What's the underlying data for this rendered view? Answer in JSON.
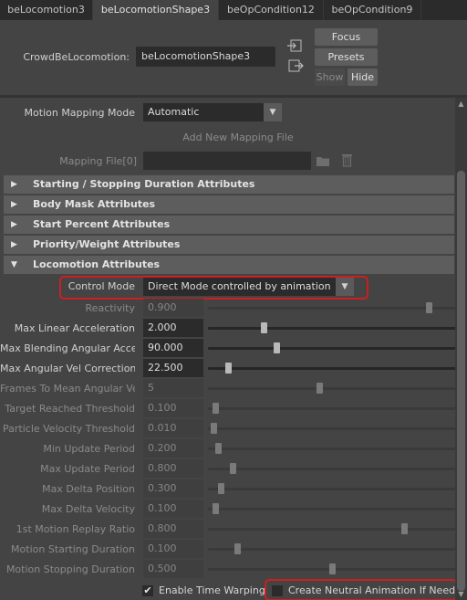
{
  "tabs": [
    "beLocomotion3",
    "beLocomotionShape3",
    "beOpCondition12",
    "beOpCondition9"
  ],
  "active_tab_index": 1,
  "header": {
    "node_type_label": "CrowdBeLocomotion:",
    "node_name": "beLocomotionShape3",
    "focus_label": "Focus",
    "presets_label": "Presets",
    "show_label": "Show",
    "hide_label": "Hide"
  },
  "mapping": {
    "mode_label": "Motion Mapping Mode",
    "mode_value": "Automatic",
    "add_button_label": "Add New Mapping File",
    "file_label": "Mapping File[0]",
    "file_value": ""
  },
  "sections": [
    {
      "label": "Starting / Stopping Duration Attributes",
      "expanded": false
    },
    {
      "label": "Body Mask Attributes",
      "expanded": false
    },
    {
      "label": "Start Percent Attributes",
      "expanded": false
    },
    {
      "label": "Priority/Weight Attributes",
      "expanded": false
    },
    {
      "label": "Locomotion Attributes",
      "expanded": true
    }
  ],
  "locomotion": {
    "control_mode_label": "Control Mode",
    "control_mode_value": "Direct Mode controlled by animation",
    "attributes": [
      {
        "label": "Reactivity",
        "value": "0.900",
        "enabled": false,
        "slider": 0.9
      },
      {
        "label": "Max Linear Acceleration",
        "value": "2.000",
        "enabled": true,
        "slider": 0.22
      },
      {
        "label": "Max Blending Angular Accel",
        "value": "90.000",
        "enabled": true,
        "slider": 0.27
      },
      {
        "label": "Max Angular Vel Correction",
        "value": "22.500",
        "enabled": true,
        "slider": 0.07
      },
      {
        "label": "Frames To Mean Angular Vel",
        "value": "5",
        "enabled": false,
        "slider": 0.45
      },
      {
        "label": "Target Reached Threshold",
        "value": "0.100",
        "enabled": false,
        "slider": 0.02
      },
      {
        "label": "Particle Velocity Threshold",
        "value": "0.010",
        "enabled": false,
        "slider": 0.01
      },
      {
        "label": "Min Update Period",
        "value": "0.200",
        "enabled": false,
        "slider": 0.03
      },
      {
        "label": "Max Update Period",
        "value": "0.800",
        "enabled": false,
        "slider": 0.09
      },
      {
        "label": "Max Delta Position",
        "value": "0.300",
        "enabled": false,
        "slider": 0.04
      },
      {
        "label": "Max Delta Velocity",
        "value": "0.100",
        "enabled": false,
        "slider": 0.02
      },
      {
        "label": "1st Motion Replay Ratio",
        "value": "0.800",
        "enabled": false,
        "slider": 0.8
      },
      {
        "label": "Motion Starting Duration",
        "value": "0.100",
        "enabled": false,
        "slider": 0.11
      },
      {
        "label": "Motion Stopping Duration",
        "value": "0.500",
        "enabled": false,
        "slider": 0.5
      }
    ],
    "time_warping_label": "Enable Time Warping",
    "time_warping_checked": true,
    "neutral_anim_label": "Create Neutral Animation If Needed",
    "neutral_anim_checked": false
  },
  "colors": {
    "highlight": "#cc1f1f",
    "background": "#444444",
    "section": "#5d5d5d"
  }
}
